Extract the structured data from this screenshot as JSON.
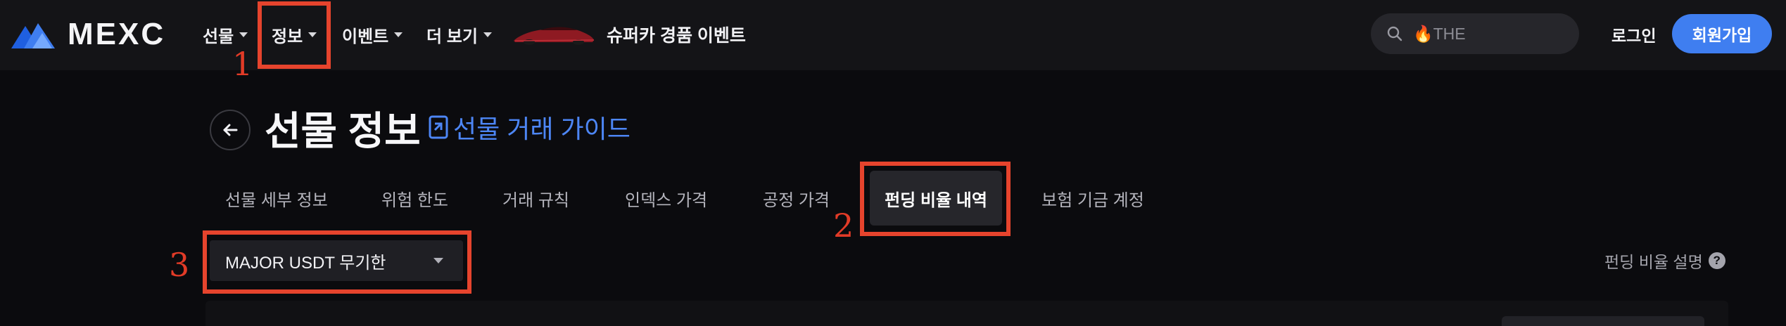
{
  "header": {
    "logo_text": "MEXC",
    "nav": [
      {
        "label": "선물"
      },
      {
        "label": "정보"
      },
      {
        "label": "이벤트"
      },
      {
        "label": "더 보기"
      }
    ],
    "promo_text": "슈퍼카 경품 이벤트",
    "search_placeholder": "🔥THE",
    "login_label": "로그인",
    "signup_label": "회원가입"
  },
  "page": {
    "title": "선물 정보",
    "guide_link": "선물 거래 가이드",
    "tabs": [
      {
        "label": "선물 세부 정보"
      },
      {
        "label": "위험 한도"
      },
      {
        "label": "거래 규칙"
      },
      {
        "label": "인덱스 가격"
      },
      {
        "label": "공정 가격"
      },
      {
        "label": "펀딩 비율 내역",
        "active": true
      },
      {
        "label": "보험 기금 계정"
      }
    ],
    "select_value": "MAJOR USDT 무기한",
    "funding_explain": "펀딩 비율 설명",
    "help_glyph": "?"
  },
  "annotations": {
    "labels": [
      "1",
      "2",
      "3"
    ],
    "color": "#e6442d"
  },
  "colors": {
    "accent": "#3f7ef0",
    "link": "#4d86f5",
    "background": "#0b0b0e",
    "topbar": "#141417"
  }
}
